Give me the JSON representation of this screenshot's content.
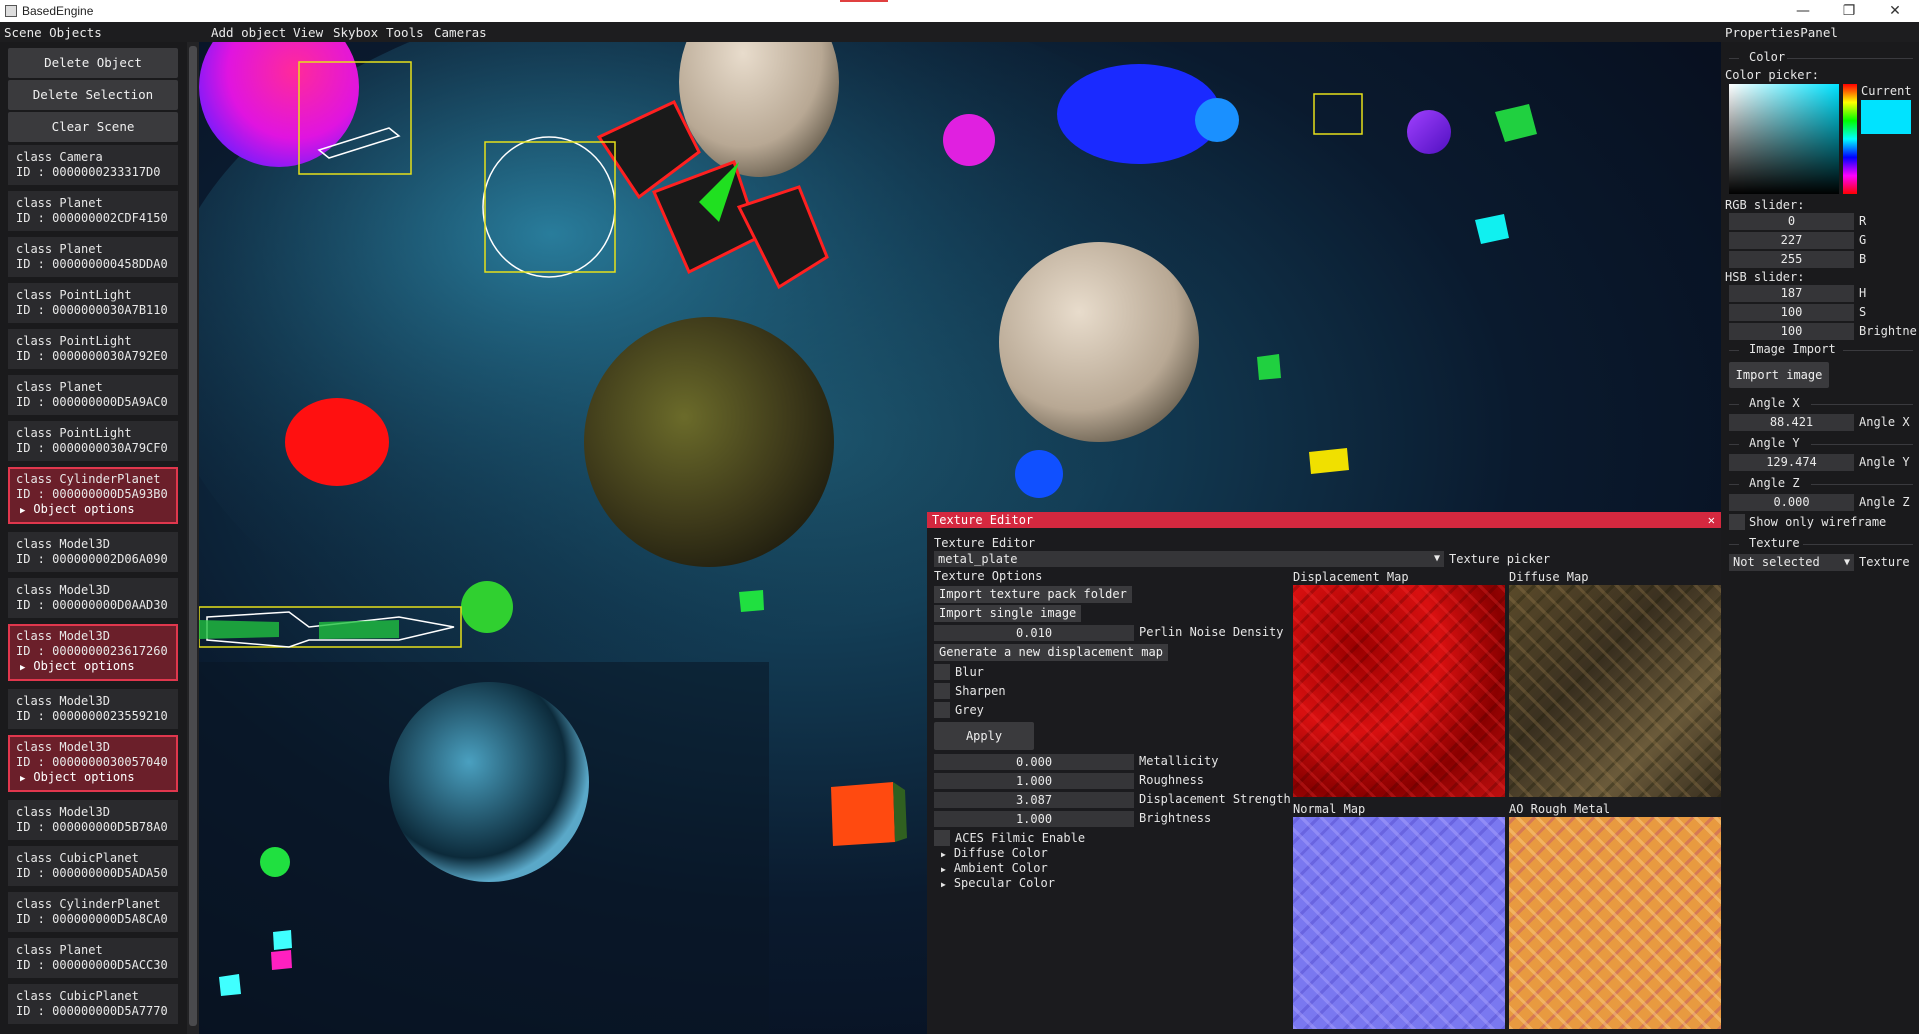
{
  "window": {
    "title": "BasedEngine",
    "minimize_glyph": "—",
    "maximize_glyph": "❐",
    "close_glyph": "✕"
  },
  "menubar": {
    "scene_objects": "Scene Objects",
    "add_object": "Add object",
    "view": "View",
    "skybox": "Skybox",
    "tools": "Tools",
    "cameras": "Cameras",
    "properties_panel": "PropertiesPanel"
  },
  "left_panel": {
    "delete_object": "Delete Object",
    "delete_selection": "Delete Selection",
    "clear_scene": "Clear Scene",
    "object_options_label": "Object options",
    "items": [
      {
        "cls": "class Camera",
        "id": "ID : 0000000233317D0",
        "selected": false
      },
      {
        "cls": "class Planet",
        "id": "ID : 000000002CDF4150",
        "selected": false
      },
      {
        "cls": "class Planet",
        "id": "ID : 000000000458DDA0",
        "selected": false
      },
      {
        "cls": "class PointLight",
        "id": "ID : 0000000030A7B110",
        "selected": false
      },
      {
        "cls": "class PointLight",
        "id": "ID : 0000000030A792E0",
        "selected": false
      },
      {
        "cls": "class Planet",
        "id": "ID : 000000000D5A9AC0",
        "selected": false
      },
      {
        "cls": "class PointLight",
        "id": "ID : 0000000030A79CF0",
        "selected": false
      },
      {
        "cls": "class CylinderPlanet",
        "id": "ID : 000000000D5A93B0",
        "selected": true
      },
      {
        "cls": "class Model3D",
        "id": "ID : 000000002D06A090",
        "selected": false
      },
      {
        "cls": "class Model3D",
        "id": "ID : 000000000D0AAD30",
        "selected": false
      },
      {
        "cls": "class Model3D",
        "id": "ID : 0000000023617260",
        "selected": true
      },
      {
        "cls": "class Model3D",
        "id": "ID : 0000000023559210",
        "selected": false
      },
      {
        "cls": "class Model3D",
        "id": "ID : 0000000030057040",
        "selected": true
      },
      {
        "cls": "class Model3D",
        "id": "ID : 000000000D5B78A0",
        "selected": false
      },
      {
        "cls": "class CubicPlanet",
        "id": "ID : 000000000D5ADA50",
        "selected": false
      },
      {
        "cls": "class CylinderPlanet",
        "id": "ID : 000000000D5A8CA0",
        "selected": false
      },
      {
        "cls": "class Planet",
        "id": "ID : 000000000D5ACC30",
        "selected": false
      },
      {
        "cls": "class CubicPlanet",
        "id": "ID : 000000000D5A7770",
        "selected": false
      }
    ]
  },
  "texture_editor": {
    "window_title": "Texture Editor",
    "heading": "Texture Editor",
    "texture_value": "metal_plate",
    "texture_picker_label": "Texture picker",
    "options_heading": "Texture Options",
    "import_pack": "Import texture pack folder",
    "import_single": "Import single image",
    "perlin_value": "0.010",
    "perlin_label": "Perlin Noise Density",
    "generate": "Generate a new displacement map",
    "blur": "Blur",
    "sharpen": "Sharpen",
    "grey": "Grey",
    "apply": "Apply",
    "metallicity_value": "0.000",
    "metallicity_label": "Metallicity",
    "roughness_value": "1.000",
    "roughness_label": "Roughness",
    "displacement_value": "3.087",
    "displacement_label": "Displacement Strength",
    "brightness_value": "1.000",
    "brightness_label": "Brightness",
    "aces": "ACES Filmic Enable",
    "diffuse_color": "Diffuse Color",
    "ambient_color": "Ambient Color",
    "specular_color": "Specular Color",
    "map_displacement": "Displacement Map",
    "map_diffuse": "Diffuse Map",
    "map_normal": "Normal Map",
    "map_ao": "AO Rough Metal"
  },
  "properties": {
    "color_header": "Color",
    "color_picker_label": "Color picker:",
    "current_label": "Current",
    "current_color": "#00E3FF",
    "rgb_label": "RGB slider:",
    "r": "0",
    "g": "227",
    "b": "255",
    "r_lbl": "R",
    "g_lbl": "G",
    "b_lbl": "B",
    "hsb_label": "HSB slider:",
    "h": "187",
    "s": "100",
    "br": "100",
    "h_lbl": "H",
    "s_lbl": "S",
    "br_lbl": "Brightne",
    "image_import_header": "Image Import",
    "import_image": "Import image",
    "angle_x_header": "Angle X",
    "angle_x": "88.421",
    "angle_x_lbl": "Angle X",
    "angle_y_header": "Angle Y",
    "angle_y": "129.474",
    "angle_y_lbl": "Angle Y",
    "angle_z_header": "Angle Z",
    "angle_z": "0.000",
    "angle_z_lbl": "Angle Z",
    "wireframe": "Show only wireframe",
    "texture_header": "Texture",
    "texture_select": "Not selected",
    "texture_lbl": "Texture"
  }
}
